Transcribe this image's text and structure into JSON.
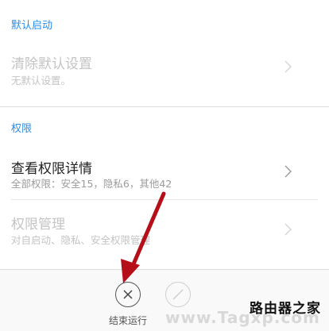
{
  "sections": {
    "default_launch": {
      "header": "默认启动"
    },
    "permissions": {
      "header": "权限"
    }
  },
  "rows": {
    "clear_defaults": {
      "title": "清除默认设置",
      "subtitle": "无默认设置。",
      "enabled": false
    },
    "view_permissions": {
      "title": "查看权限详情",
      "subtitle": "全部权限：安全15，隐私6，其他42",
      "enabled": true
    },
    "manage_permissions": {
      "title": "权限管理",
      "subtitle": "对自启动、隐私、安全权限管理",
      "enabled": false
    }
  },
  "bottom_bar": {
    "stop": {
      "label": "结束运行",
      "icon": "close-icon"
    },
    "disable": {
      "label": "",
      "icon": "block-icon"
    }
  },
  "watermark": {
    "text": "路由器之家",
    "url": "www.Tagxp.com"
  },
  "colors": {
    "accent": "#2a8de6",
    "arrow": "#b5101a"
  }
}
